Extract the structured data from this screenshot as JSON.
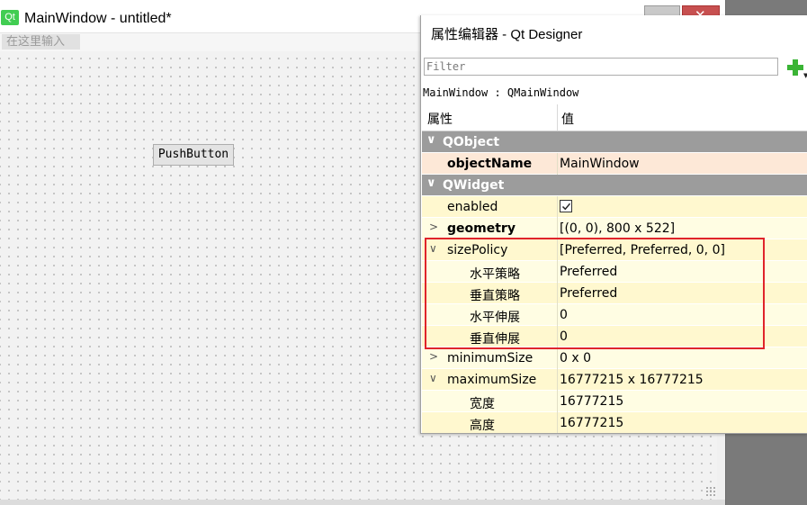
{
  "main_window": {
    "logo_text": "Qt",
    "title": "MainWindow - untitled*",
    "close_glyph": "✕",
    "menu_placeholder": "在这里输入",
    "push_button_label": "PushButton"
  },
  "property_editor": {
    "title": "属性编辑器 - Qt Designer",
    "filter_placeholder": "Filter",
    "object_class": "MainWindow : QMainWindow",
    "header_name": "属性",
    "header_value": "值",
    "rows": [
      {
        "kind": "group",
        "name": "QObject",
        "chevron": "∨"
      },
      {
        "kind": "prop",
        "name": "objectName",
        "value": "MainWindow",
        "bold": true
      },
      {
        "kind": "group",
        "name": "QWidget",
        "chevron": "∨"
      },
      {
        "kind": "prop",
        "name": "enabled",
        "value": "checked"
      },
      {
        "kind": "prop",
        "name": "geometry",
        "value": "[(0, 0), 800 x 522]",
        "bold": true,
        "chevron": ">"
      },
      {
        "kind": "prop",
        "name": "sizePolicy",
        "value": "[Preferred, Preferred, 0, 0]",
        "chevron": "∨"
      },
      {
        "kind": "sub",
        "name": "水平策略",
        "value": "Preferred"
      },
      {
        "kind": "sub",
        "name": "垂直策略",
        "value": "Preferred"
      },
      {
        "kind": "sub",
        "name": "水平伸展",
        "value": "0"
      },
      {
        "kind": "sub",
        "name": "垂直伸展",
        "value": "0"
      },
      {
        "kind": "prop",
        "name": "minimumSize",
        "value": "0 x 0",
        "chevron": ">"
      },
      {
        "kind": "prop",
        "name": "maximumSize",
        "value": "16777215 x 16777215",
        "chevron": "∨"
      },
      {
        "kind": "sub",
        "name": "宽度",
        "value": "16777215"
      },
      {
        "kind": "sub",
        "name": "高度",
        "value": "16777215"
      }
    ]
  },
  "colors": {
    "group_header": "#9c9c9c",
    "row_yellow": "#fff8cf",
    "row_light": "#fffde3",
    "object_row": "#fde8d7",
    "highlight": "#e0242b",
    "add_icon": "#3ab435"
  },
  "icons": [
    "qt-logo-icon",
    "add-property-icon",
    "chevron-down-icon",
    "chevron-right-icon",
    "checkbox-checked-icon",
    "size-grip-icon"
  ]
}
